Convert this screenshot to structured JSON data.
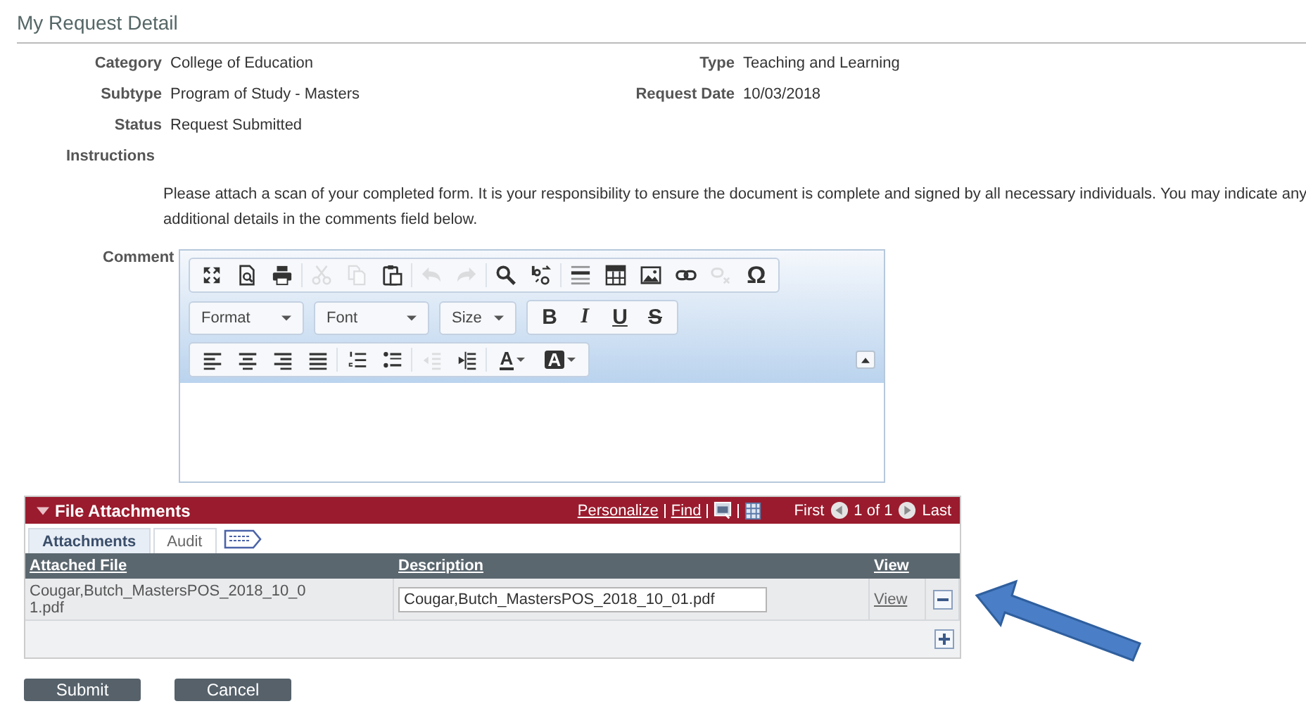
{
  "page_title": "My Request Detail",
  "fields_left": [
    {
      "label": "Category",
      "value": "College of Education"
    },
    {
      "label": "Subtype",
      "value": "Program of Study - Masters"
    },
    {
      "label": "Status",
      "value": "Request Submitted"
    }
  ],
  "fields_right": [
    {
      "label": "Type",
      "value": "Teaching and Learning"
    },
    {
      "label": "Request Date",
      "value": "10/03/2018"
    }
  ],
  "instructions": {
    "label": "Instructions",
    "text": "Please attach a scan of your completed form. It is your responsibility to ensure the document is complete and signed by all necessary individuals. You may indicate any additional details in the comments field below."
  },
  "comment": {
    "label": "Comment",
    "toolbar_row_1": [
      {
        "disabled": false
      },
      {
        "disabled": false
      },
      {
        "disabled": false
      },
      {
        "disabled": true
      },
      {
        "disabled": true
      },
      {
        "disabled": false
      },
      {
        "disabled": true
      },
      {
        "disabled": true
      },
      {
        "disabled": false
      },
      {
        "disabled": false
      },
      {
        "disabled": false
      },
      {
        "disabled": false
      },
      {
        "disabled": false
      },
      {
        "disabled": false
      },
      {
        "disabled": true
      },
      {
        "disabled": false,
        "label": "Ω"
      }
    ],
    "dropdowns": [
      "Format",
      "Font",
      "Size"
    ],
    "style_buttons": [
      "B",
      "I",
      "U",
      "S"
    ],
    "toolbar_row_3": [
      {
        "disabled": false
      },
      {
        "disabled": false
      },
      {
        "disabled": false
      },
      {
        "disabled": false
      },
      {
        "disabled": false
      },
      {
        "disabled": false
      },
      {
        "disabled": true
      },
      {
        "disabled": false
      },
      {
        "disabled": false,
        "label": "A"
      },
      {
        "disabled": false,
        "label": "A"
      }
    ]
  },
  "attachments": {
    "title": "File Attachments",
    "links": [
      "Personalize",
      "Find"
    ],
    "nav_first": "First",
    "nav_count": "1 of 1",
    "nav_last": "Last",
    "tabs": [
      {
        "label": "Attachments",
        "selected": true
      },
      {
        "label": "Audit",
        "selected": false
      }
    ],
    "columns": [
      "Attached File",
      "Description",
      "View"
    ],
    "rows": [
      {
        "file": "Cougar,Butch_MastersPOS_2018_10_0\n1.pdf",
        "description": "Cougar,Butch_MastersPOS_2018_10_01.pdf",
        "view": "View"
      }
    ]
  },
  "buttons": [
    "Submit",
    "Cancel"
  ]
}
